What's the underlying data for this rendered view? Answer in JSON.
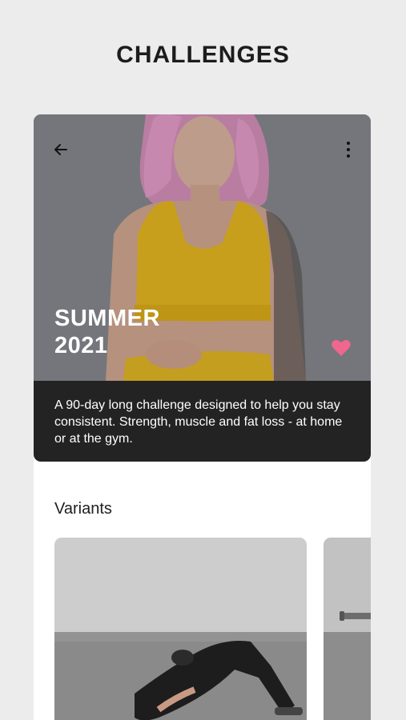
{
  "header": {
    "title": "CHALLENGES"
  },
  "challenge": {
    "title_line1": "SUMMER",
    "title_line2": "2021",
    "description": "A 90-day long challenge designed to help you stay consistent. Strength, muscle and fat loss - at home or at the gym.",
    "favorited": true
  },
  "variants": {
    "section_title": "Variants"
  },
  "colors": {
    "background": "#ececec",
    "description_box": "#232323",
    "favorite": "#f0668c"
  },
  "icons": {
    "back": "arrow-left-icon",
    "more": "more-vertical-icon",
    "favorite": "heart-icon"
  }
}
